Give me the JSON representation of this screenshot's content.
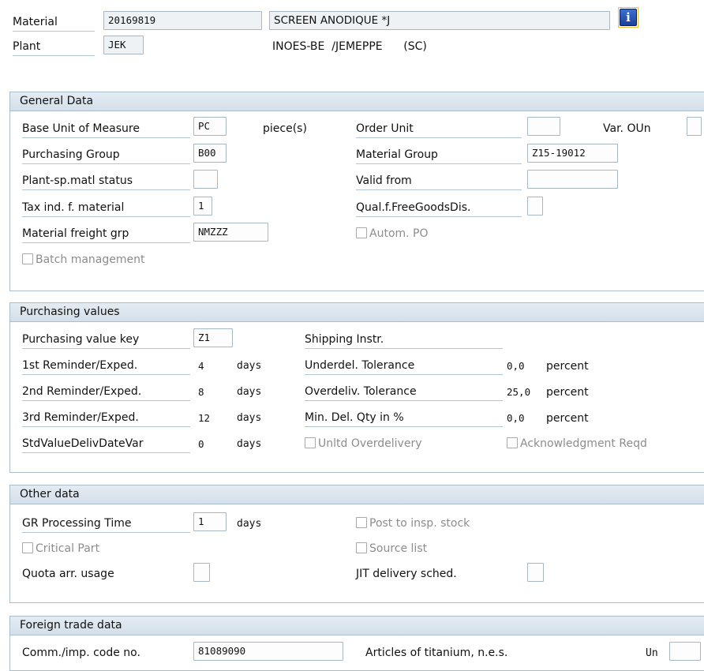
{
  "header": {
    "material_label": "Material",
    "material_value": "20169819",
    "material_desc": "SCREEN ANODIQUE *J",
    "plant_label": "Plant",
    "plant_value": "JEK",
    "plant_desc": "INOES-BE  /JEMEPPE      (SC)",
    "info_icon": "info-icon",
    "info_glyph": "i"
  },
  "general": {
    "title": "General Data",
    "base_uom_label": "Base Unit of Measure",
    "base_uom_value": "PC",
    "base_uom_text": "piece(s)",
    "order_unit_label": "Order Unit",
    "order_unit_value": "",
    "var_oun_label": "Var. OUn",
    "var_oun_value": "",
    "purch_group_label": "Purchasing Group",
    "purch_group_value": "B00",
    "mat_group_label": "Material Group",
    "mat_group_value": "Z15-19012",
    "plant_status_label": "Plant-sp.matl status",
    "plant_status_value": "",
    "valid_from_label": "Valid from",
    "valid_from_value": "",
    "tax_label": "Tax ind. f. material",
    "tax_value": "1",
    "qual_label": "Qual.f.FreeGoodsDis.",
    "qual_value": "",
    "freight_label": "Material freight grp",
    "freight_value": "NMZZZ",
    "autom_po_label": "Autom. PO",
    "batch_label": "Batch management"
  },
  "purchasing": {
    "title": "Purchasing values",
    "pv_key_label": "Purchasing value key",
    "pv_key_value": "Z1",
    "shipping_label": "Shipping Instr.",
    "r1_label": "1st Reminder/Exped.",
    "r1_value": "4",
    "r2_label": "2nd Reminder/Exped.",
    "r2_value": "8",
    "r3_label": "3rd Reminder/Exped.",
    "r3_value": "12",
    "std_label": "StdValueDelivDateVar",
    "std_value": "0",
    "days": "days",
    "under_label": "Underdel. Tolerance",
    "under_value": "0,0",
    "over_label": "Overdeliv. Tolerance",
    "over_value": "25,0",
    "min_label": "Min. Del. Qty in %",
    "min_value": "0,0",
    "percent": "percent",
    "unltd_label": "Unltd Overdelivery",
    "ack_label": "Acknowledgment Reqd"
  },
  "other": {
    "title": "Other data",
    "gr_label": "GR Processing Time",
    "gr_value": "1",
    "gr_unit": "days",
    "post_insp_label": "Post to insp. stock",
    "critical_label": "Critical Part",
    "source_label": "Source list",
    "quota_label": "Quota arr. usage",
    "quota_value": "",
    "jit_label": "JIT delivery sched.",
    "jit_value": ""
  },
  "foreign": {
    "title": "Foreign trade data",
    "comm_label": "Comm./imp. code no.",
    "comm_value": "81089090",
    "comm_desc": "Articles of titanium, n.e.s.",
    "un_label": "Un",
    "un_value": ""
  },
  "colors": {
    "group_header": "#d9e4ee",
    "border": "#aabdcc",
    "field_border": "#a7b7c4",
    "info_blue": "#1d3f9c"
  }
}
